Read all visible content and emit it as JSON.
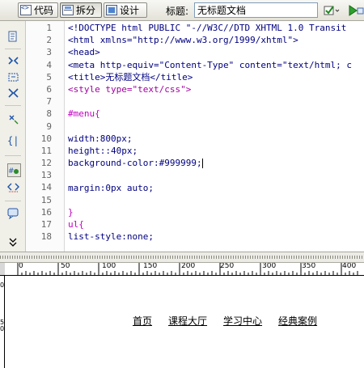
{
  "toolbar": {
    "view_buttons": [
      {
        "label": "代码",
        "icon": "code-view-icon"
      },
      {
        "label": "拆分",
        "icon": "split-view-icon"
      },
      {
        "label": "设计",
        "icon": "design-view-icon"
      }
    ],
    "active_view": "拆分",
    "title_label": "标题:",
    "title_value": "无标题文档",
    "icons": [
      "browser-check-icon",
      "preview-icon"
    ]
  },
  "left_rail": {
    "icons": [
      "open-document-icon",
      "expand-all-icon",
      "select-parent-tag-icon",
      "balance-braces-icon",
      "line-numbers-icon",
      "highlight-invalid-icon",
      "syntax-coloring-icon",
      "wrap-tag-icon",
      "recent-snippets-icon",
      "more-icon"
    ]
  },
  "code": {
    "line_numbers": [
      "1",
      "2",
      "3",
      "4",
      "5",
      "6",
      "7",
      "8",
      "9",
      "10",
      "11",
      "12",
      "13",
      "14",
      "15",
      "16",
      "17",
      "18"
    ],
    "lines": [
      "<!DOCTYPE html PUBLIC \"-//W3C//DTD XHTML 1.0 Transit",
      "<html xmlns=\"http://www.w3.org/1999/xhtml\">",
      "<head>",
      "<meta http-equiv=\"Content-Type\" content=\"text/html; c",
      "<title>无标题文档</title>",
      "<style type=\"text/css\">",
      "",
      "#menu{",
      "",
      "width:800px;",
      "height::40px;",
      "background-color:#999999;",
      "",
      "margin:0px auto;",
      "",
      "}",
      "ul{",
      "list-style:none;"
    ]
  },
  "ruler": {
    "h_labels": [
      "0",
      "50",
      "100",
      "150",
      "200",
      "250",
      "300",
      "350",
      "400"
    ],
    "v_labels": [
      "0",
      "5",
      "0"
    ]
  },
  "design": {
    "menu_items": [
      "首页",
      "课程大厅",
      "学习中心",
      "经典案例"
    ]
  },
  "colors": {
    "toolbar_bg": "#e4e2d8",
    "tag": "#000080",
    "css_selector": "#c000c0",
    "css_value": "#0000cc"
  }
}
